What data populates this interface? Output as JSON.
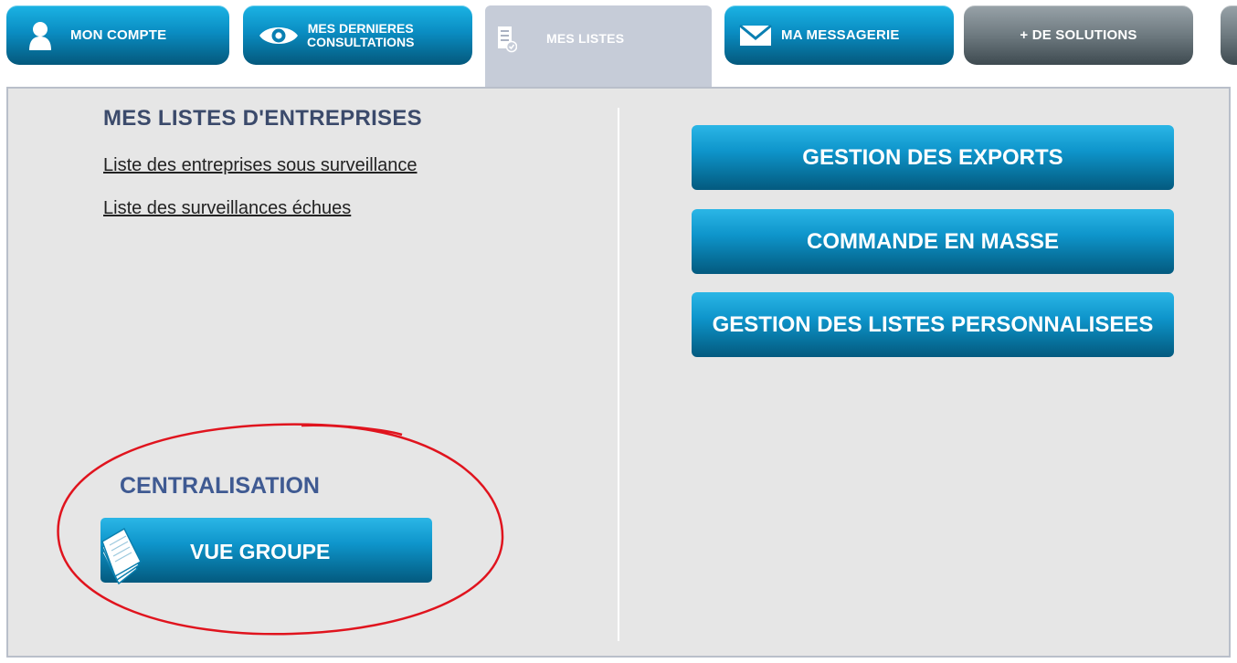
{
  "tabs": [
    {
      "label": "MON COMPTE",
      "icon": "user-icon"
    },
    {
      "label_line1": "MES DERNIERES",
      "label_line2": "CONSULTATIONS",
      "icon": "eye-icon"
    },
    {
      "label": "MES LISTES",
      "icon": "document-check-icon",
      "active": true
    },
    {
      "label": "MA MESSAGERIE",
      "icon": "envelope-icon"
    },
    {
      "label": "+ DE SOLUTIONS"
    }
  ],
  "left": {
    "title": "MES LISTES D'ENTREPRISES",
    "links": [
      "Liste des entreprises sous surveillance",
      "Liste des surveillances échues"
    ],
    "centralisation_title": "CENTRALISATION",
    "vue_groupe_label": "VUE GROUPE"
  },
  "right": {
    "buttons": [
      "GESTION DES EXPORTS",
      "COMMANDE EN MASSE",
      "GESTION DES LISTES PERSONNALISEES"
    ]
  },
  "colors": {
    "accent_blue": "#0e95cb",
    "panel_bg": "#e6e6e6",
    "title_navy": "#3b4a6b",
    "annotation_red": "#e0141e"
  }
}
